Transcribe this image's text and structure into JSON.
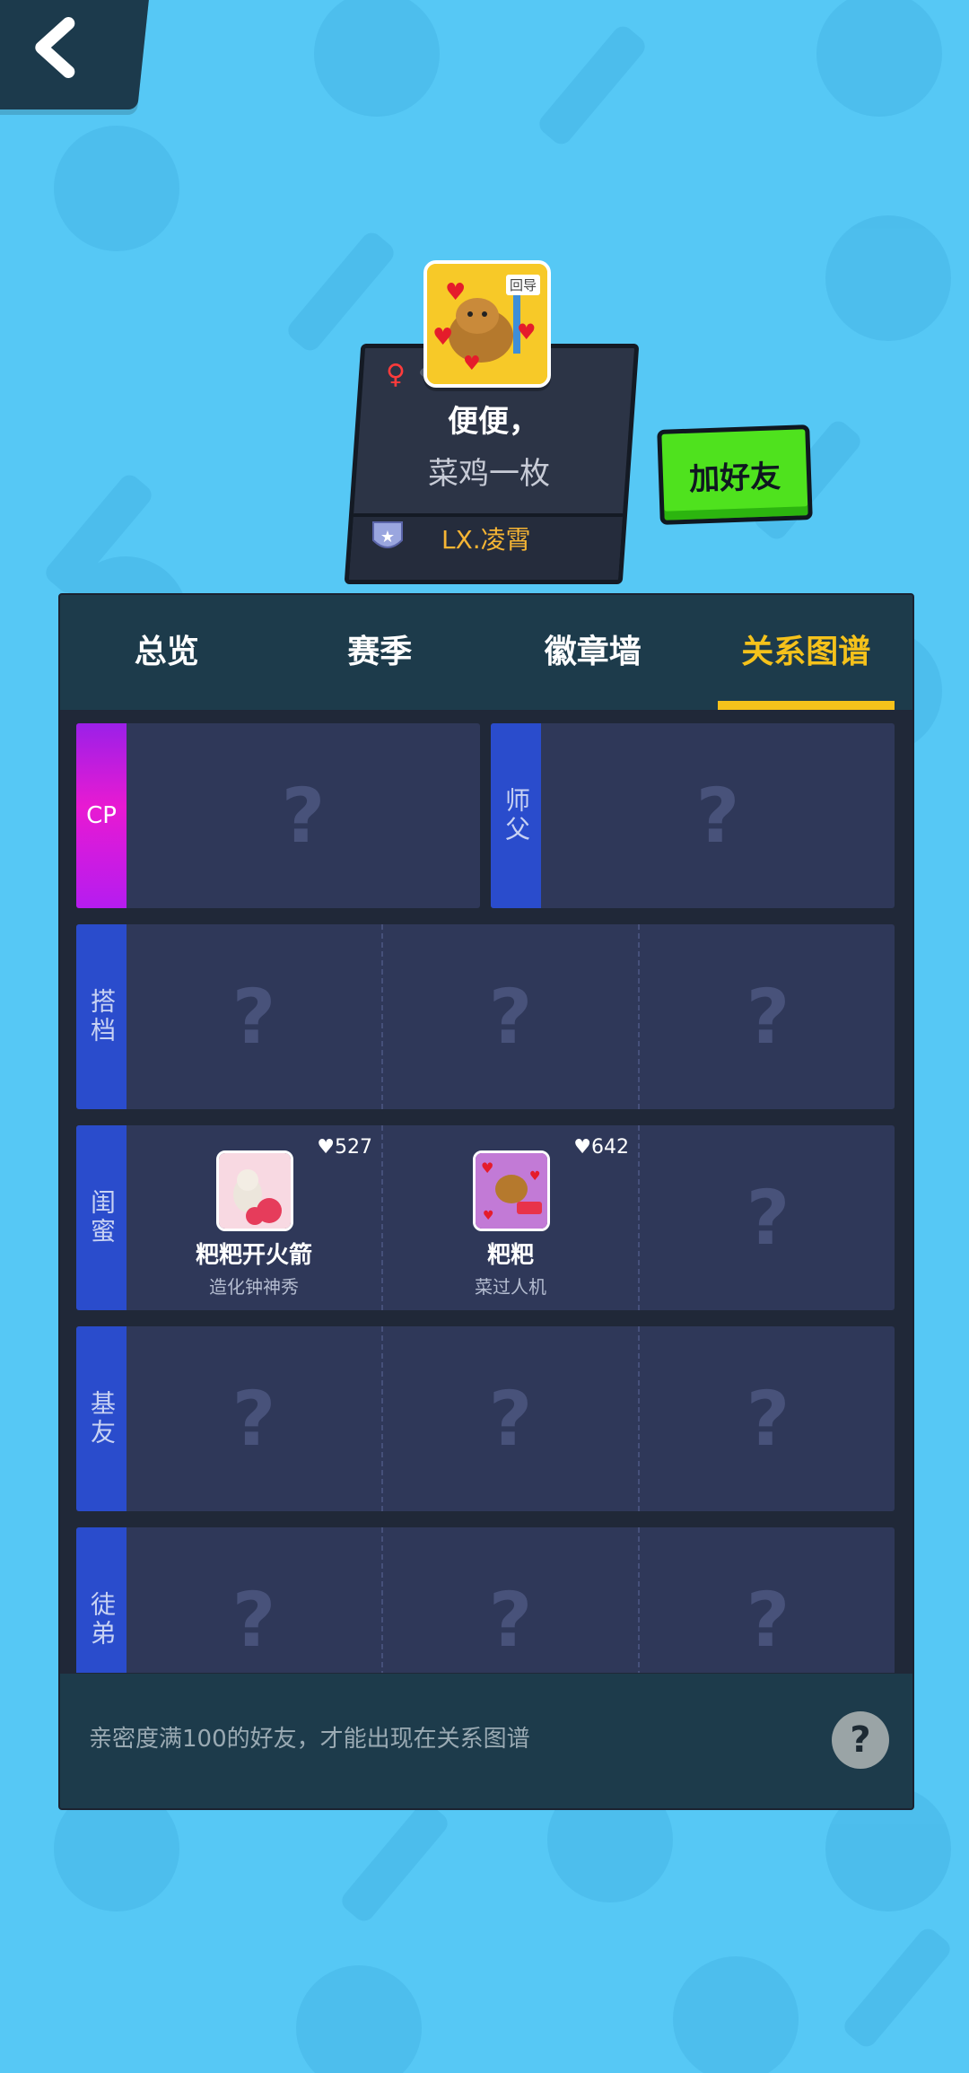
{
  "profile": {
    "name": "便便，",
    "signature": "菜鸡一枚",
    "gender_symbol": "♀",
    "team": "LX.凌霄",
    "avatar_tag": "回导",
    "add_friend_label": "加好友"
  },
  "tabs": [
    {
      "label": "总览",
      "active": false
    },
    {
      "label": "赛季",
      "active": false
    },
    {
      "label": "徽章墙",
      "active": false
    },
    {
      "label": "关系图谱",
      "active": true
    }
  ],
  "relations": {
    "cp_label": "CP",
    "master_label": "师父",
    "partner_label": "搭档",
    "bestie_label": "闺蜜",
    "buddy_label": "基友",
    "apprentice_label": "徒弟",
    "empty_mark": "?",
    "besties": [
      {
        "name": "粑粑开火箭",
        "sub": "造化钟神秀",
        "intimacy": "527"
      },
      {
        "name": "粑粑",
        "sub": "菜过人机",
        "intimacy": "642"
      }
    ]
  },
  "footer": {
    "note": "亲密度满100的好友，才能出现在关系图谱",
    "help_mark": "?"
  },
  "colors": {
    "background": "#56c8f5",
    "panel": "#202838",
    "tab_active": "#f5c21b",
    "row_label": "#2a4ccc",
    "add_friend": "#4fe21e"
  }
}
